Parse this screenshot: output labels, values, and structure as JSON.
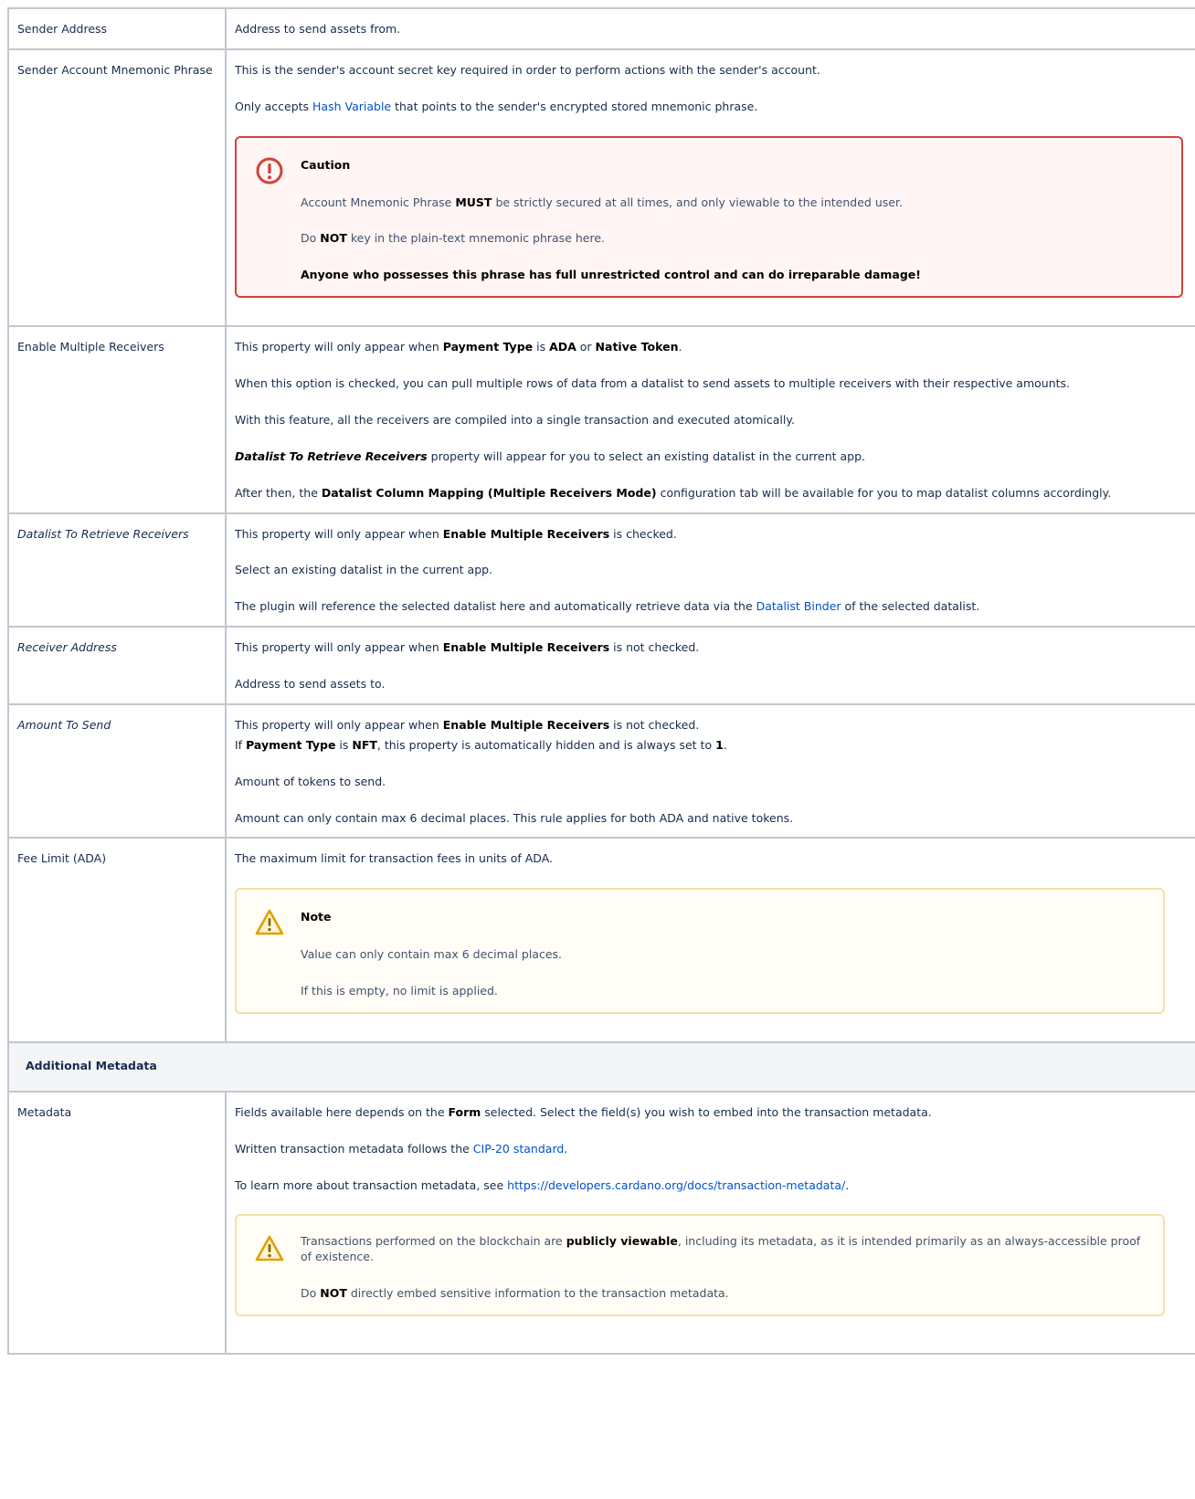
{
  "rows": {
    "sender_address": {
      "key": "Sender Address",
      "text": "Address to send assets from."
    },
    "mnemonic": {
      "key": "Sender Account Mnemonic Phrase",
      "p1": "This is the sender's account secret key required in order to perform actions with the sender's account.",
      "p2_pre": "Only accepts ",
      "p2_link": "Hash Variable",
      "p2_post": " that points to the sender's encrypted stored mnemonic phrase.",
      "caution": {
        "icon": "exclamation-circle-icon",
        "title": "Caution",
        "l1_pre": "Account Mnemonic Phrase ",
        "l1_bold": "MUST",
        "l1_post": " be strictly secured at all times, and only viewable to the intended user.",
        "l2_pre": "Do ",
        "l2_bold": "NOT",
        "l2_post": " key in the plain-text mnemonic phrase here.",
        "l3": "Anyone who possesses this phrase has full unrestricted control and can do irreparable damage!"
      }
    },
    "multiple_receivers": {
      "key": "Enable Multiple Receivers",
      "p1_a": "This property will only appear when ",
      "p1_b": "Payment Type",
      "p1_c": " is ",
      "p1_d": "ADA",
      "p1_e": " or ",
      "p1_f": "Native Token",
      "p1_g": ".",
      "p2": "When this option is checked, you can pull multiple rows of data from a datalist to send assets to multiple receivers with their respective amounts.",
      "p3": "With this feature, all the receivers are compiled into a single transaction and executed atomically.",
      "p4_bold": "Datalist To Retrieve Receivers",
      "p4_post": " property will appear for you to select an existing datalist in the current app.",
      "p5_pre": "After then, the ",
      "p5_bold": "Datalist Column Mapping (Multiple Receivers Mode)",
      "p5_post": " configuration tab will be available for you to map datalist columns accordingly."
    },
    "datalist": {
      "key": "Datalist To Retrieve Receivers",
      "p1_a": "This property will only appear when ",
      "p1_b": "Enable Multiple Receivers",
      "p1_c": " is checked.",
      "p2": "Select an existing datalist in the current app.",
      "p3_pre": "The plugin will reference the selected datalist here and automatically retrieve data via the ",
      "p3_link": "Datalist Binder",
      "p3_post": " of the selected datalist."
    },
    "receiver_address": {
      "key": "Receiver Address",
      "p1_a": "This property will only appear when ",
      "p1_b": "Enable Multiple Receivers",
      "p1_c": " is not checked.",
      "p2": "Address to send assets to."
    },
    "amount": {
      "key": "Amount To Send",
      "p1_a": "This property will only appear when ",
      "p1_b": "Enable Multiple Receivers",
      "p1_c": " is not checked.",
      "p1b_a": "If ",
      "p1b_b": "Payment Type",
      "p1b_c": " is ",
      "p1b_d": "NFT",
      "p1b_e": ", this property is automatically hidden and is always set to ",
      "p1b_f": "1",
      "p1b_g": ".",
      "p2": "Amount of tokens to send.",
      "p3": "Amount can only contain max 6 decimal places. This rule applies for both ADA and native tokens."
    },
    "fee_limit": {
      "key": "Fee Limit (ADA)",
      "p1": "The maximum limit for transaction fees in units of ADA.",
      "note": {
        "icon": "warning-triangle-icon",
        "title": "Note",
        "l1": "Value can only contain max 6 decimal places.",
        "l2": "If this is empty, no limit is applied."
      }
    },
    "section_title": "Additional Metadata",
    "metadata": {
      "key": "Metadata",
      "p1_pre": "Fields available here depends on the ",
      "p1_bold": "Form",
      "p1_post": " selected. Select the field(s) you wish to embed into the transaction metadata.",
      "p2_pre": "Written transaction metadata follows the ",
      "p2_link": "CIP-20 standard",
      "p2_post": ".",
      "p3_pre": "To learn more about transaction metadata, see ",
      "p3_link": "https://developers.cardano.org/docs/transaction-metadata/",
      "p3_post": ".",
      "warn": {
        "icon": "warning-triangle-icon",
        "l1_pre": "Transactions performed on the blockchain are ",
        "l1_bold": "publicly viewable",
        "l1_post": ", including its metadata, as it is intended primarily as an always-accessible proof of existence.",
        "l2_pre": "Do ",
        "l2_bold": "NOT",
        "l2_post": " directly embed sensitive information to the transaction metadata."
      }
    }
  }
}
